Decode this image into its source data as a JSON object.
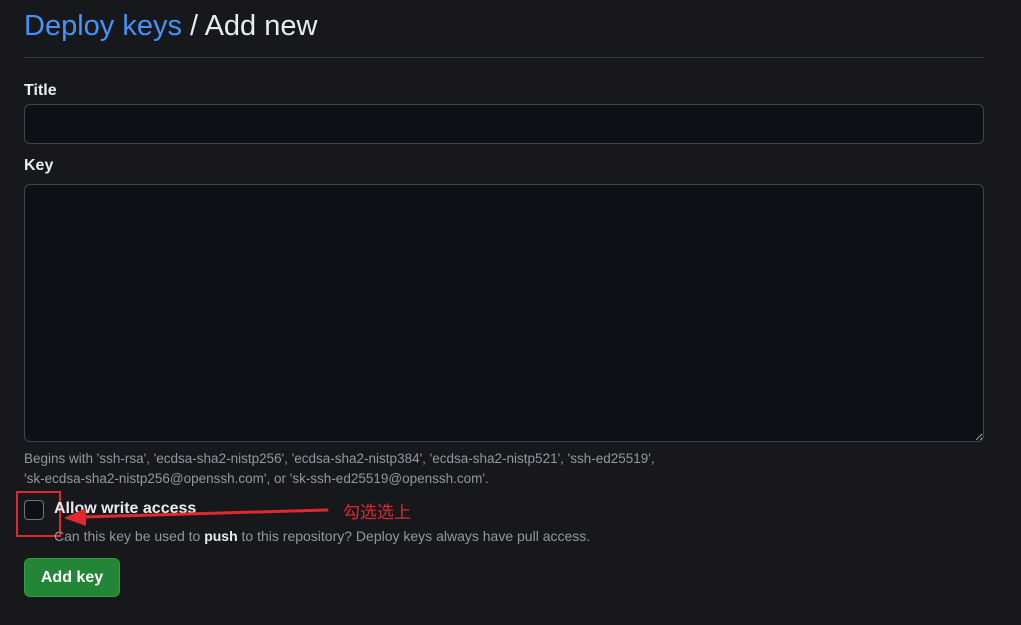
{
  "breadcrumb": {
    "parent": "Deploy keys",
    "separator": "/",
    "current": "Add new"
  },
  "form": {
    "title_label": "Title",
    "title_value": "",
    "key_label": "Key",
    "key_value": "",
    "key_hint_line1": "Begins with 'ssh-rsa', 'ecdsa-sha2-nistp256', 'ecdsa-sha2-nistp384', 'ecdsa-sha2-nistp521', 'ssh-ed25519',",
    "key_hint_line2": "'sk-ecdsa-sha2-nistp256@openssh.com', or 'sk-ssh-ed25519@openssh.com'.",
    "write_access_label": "Allow write access",
    "write_access_checked": false,
    "write_access_desc_before": "Can this key be used to ",
    "write_access_desc_bold": "push",
    "write_access_desc_after": " to this repository? Deploy keys always have pull access.",
    "submit_label": "Add key"
  },
  "annotation": {
    "text": "勾选选上",
    "color": "#e0282f"
  },
  "colors": {
    "background": "#17181b",
    "link": "#4493f8",
    "primary_button": "#238636",
    "muted_text": "#9198a1"
  }
}
